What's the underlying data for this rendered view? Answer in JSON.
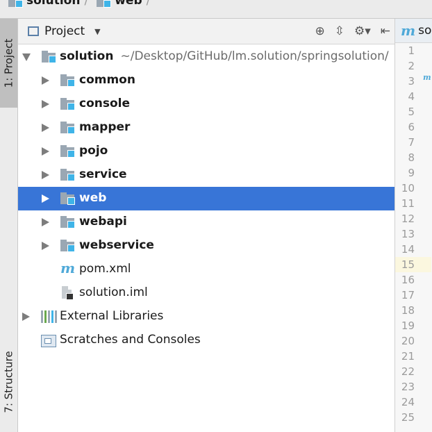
{
  "breadcrumb": {
    "items": [
      "solution",
      "web"
    ],
    "separator": "/"
  },
  "left_strip": {
    "project_tab": "1: Project",
    "structure_tab": "7: Structure"
  },
  "panel": {
    "title": "Project",
    "tools": {
      "locate": "⊕",
      "collapse": "⇳",
      "settings": "⚙▾",
      "hide": "⇤"
    }
  },
  "tree": {
    "root": {
      "name": "solution",
      "path": "~/Desktop/GitHub/lm.solution/springsolution/"
    },
    "modules": [
      {
        "name": "common"
      },
      {
        "name": "console"
      },
      {
        "name": "mapper"
      },
      {
        "name": "pojo"
      },
      {
        "name": "service"
      },
      {
        "name": "web",
        "selected": true
      },
      {
        "name": "webapi"
      },
      {
        "name": "webservice"
      }
    ],
    "files": [
      {
        "name": "pom.xml",
        "icon": "maven-icon"
      },
      {
        "name": "solution.iml",
        "icon": "iml-file-icon"
      }
    ],
    "external": "External Libraries",
    "scratches": "Scratches and Consoles"
  },
  "editor": {
    "tab_label": "so",
    "tab_icon": "m",
    "line_numbers": [
      "1",
      "2",
      "3",
      "4",
      "5",
      "6",
      "7",
      "8",
      "9",
      "10",
      "11",
      "12",
      "13",
      "14",
      "15",
      "16",
      "17",
      "18",
      "19",
      "20",
      "21",
      "22",
      "23",
      "24",
      "25"
    ],
    "current_line": "15"
  },
  "colors": {
    "selection": "#3875d7",
    "module_badge": "#3fb4e8",
    "folder": "#9aa7b3",
    "maven": "#4fa9d8"
  }
}
